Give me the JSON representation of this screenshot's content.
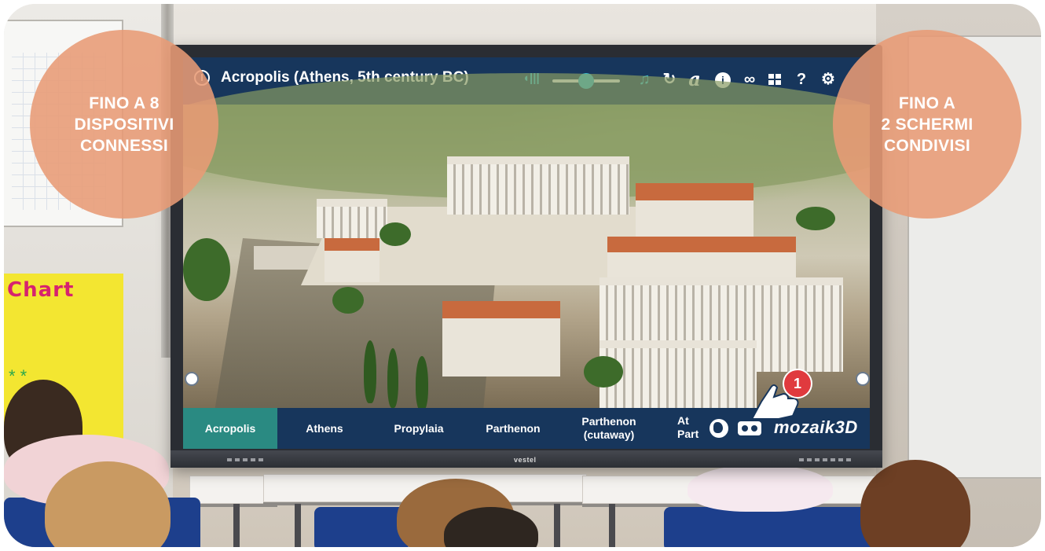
{
  "app": {
    "title": "Acropolis (Athens, 5th century BC)",
    "brand": "mozaik3D",
    "volume": 0.5
  },
  "toolbar": {
    "icons": [
      "info-circle-icon",
      "volume-icon",
      "music-note-icon",
      "restart-icon",
      "text-style-icon",
      "info-icon",
      "link-icon",
      "grid-icon",
      "help-icon",
      "settings-icon"
    ],
    "glyphs": {
      "volume": "◖|||",
      "music": "♫",
      "restart": "↻",
      "text": "a",
      "info": "i",
      "link": "∞",
      "grid": "▪▪",
      "help": "?",
      "settings": "⚙"
    }
  },
  "tabs": [
    {
      "label": "Acropolis",
      "active": true
    },
    {
      "label": "Athens",
      "active": false
    },
    {
      "label": "Propylaia",
      "active": false
    },
    {
      "label": "Parthenon",
      "active": false
    },
    {
      "label": "Parthenon (cutaway)",
      "active": false
    },
    {
      "label": "At Part",
      "active": false
    }
  ],
  "tab_lines": {
    "cutaway_line1": "Parthenon",
    "cutaway_line2": "(cutaway)",
    "partial_line1": "At",
    "partial_line2": "Part"
  },
  "display": {
    "bezel_brand": "vestel"
  },
  "notification": {
    "count": "1"
  },
  "promo": {
    "left": [
      "FINO A 8",
      "DISPOSITIVI",
      "CONNESSI"
    ],
    "right": [
      "FINO A",
      "2 SCHERMI",
      "CONDIVISI"
    ]
  },
  "classroom": {
    "chart_label": "Chart"
  },
  "colors": {
    "topbar": "#17365c",
    "active_tab": "#2a8a82",
    "accent": "#33c7dd",
    "bubble": "#e89b75",
    "badge": "#e03a3e"
  }
}
